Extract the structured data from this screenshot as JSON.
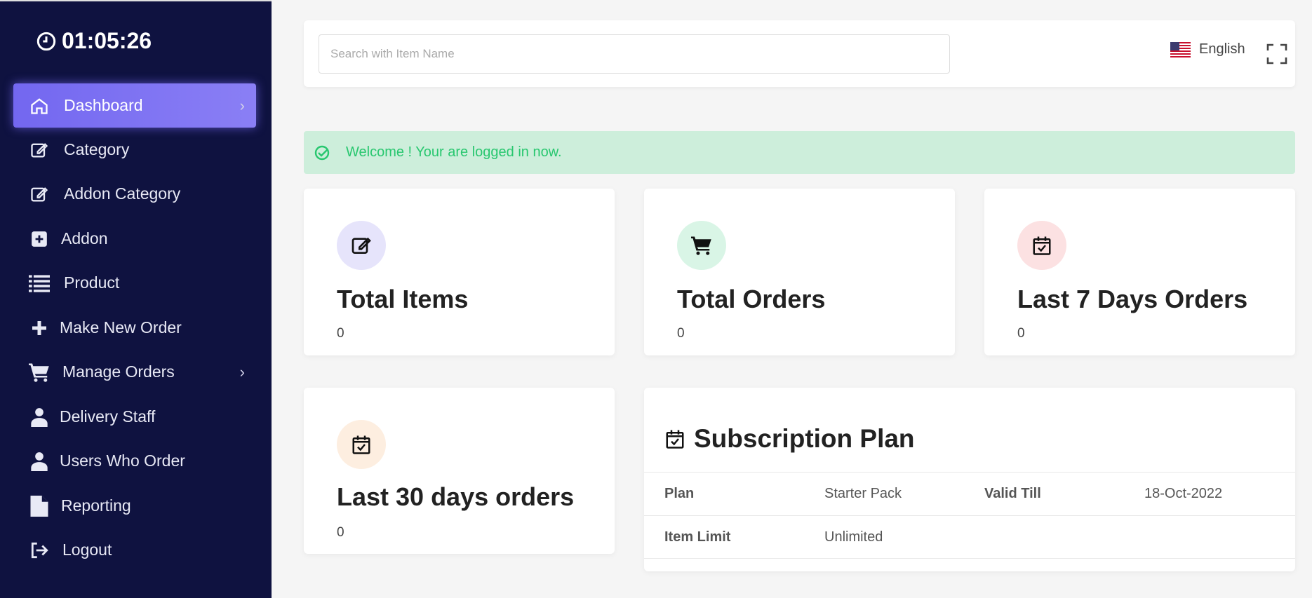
{
  "clock": "01:05:26",
  "sidebar": {
    "items": [
      {
        "label": "Dashboard",
        "icon": "home-icon",
        "active": true,
        "chevron": true
      },
      {
        "label": "Category",
        "icon": "edit-icon"
      },
      {
        "label": "Addon Category",
        "icon": "edit-icon"
      },
      {
        "label": "Addon",
        "icon": "plus-square-icon"
      },
      {
        "label": "Product",
        "icon": "list-icon"
      },
      {
        "label": "Make New Order",
        "icon": "plus-icon"
      },
      {
        "label": "Manage Orders",
        "icon": "cart-icon",
        "chevron": true
      },
      {
        "label": "Delivery Staff",
        "icon": "user-icon"
      },
      {
        "label": "Users Who Order",
        "icon": "user-icon"
      },
      {
        "label": "Reporting",
        "icon": "file-icon"
      },
      {
        "label": "Logout",
        "icon": "logout-icon"
      }
    ],
    "chevron": "›"
  },
  "header": {
    "search_placeholder": "Search with Item Name",
    "language": "English"
  },
  "alert": {
    "message": "Welcome ! Your are logged in now.",
    "color": "#28c76f"
  },
  "stats": [
    {
      "title": "Total Items",
      "value": "0",
      "icon": "edit-icon",
      "bg": "#e6e4fb"
    },
    {
      "title": "Total Orders",
      "value": "0",
      "icon": "cart-icon",
      "bg": "#d9f5e6"
    },
    {
      "title": "Last 7 Days Orders",
      "value": "0",
      "icon": "calendar-check-icon",
      "bg": "#fce1e2"
    },
    {
      "title": "Last 30 days orders",
      "value": "0",
      "icon": "calendar-check-icon",
      "bg": "#fdeee0"
    }
  ],
  "subscription": {
    "title": "Subscription Plan",
    "rows": [
      {
        "k1": "Plan",
        "v1": "Starter Pack",
        "k2": "Valid Till",
        "v2": "18-Oct-2022"
      },
      {
        "k1": "Item Limit",
        "v1": "Unlimited",
        "k2": "",
        "v2": ""
      }
    ]
  },
  "colors": {
    "sidebar_bg": "#0f1240",
    "accent": "#7367f0"
  }
}
